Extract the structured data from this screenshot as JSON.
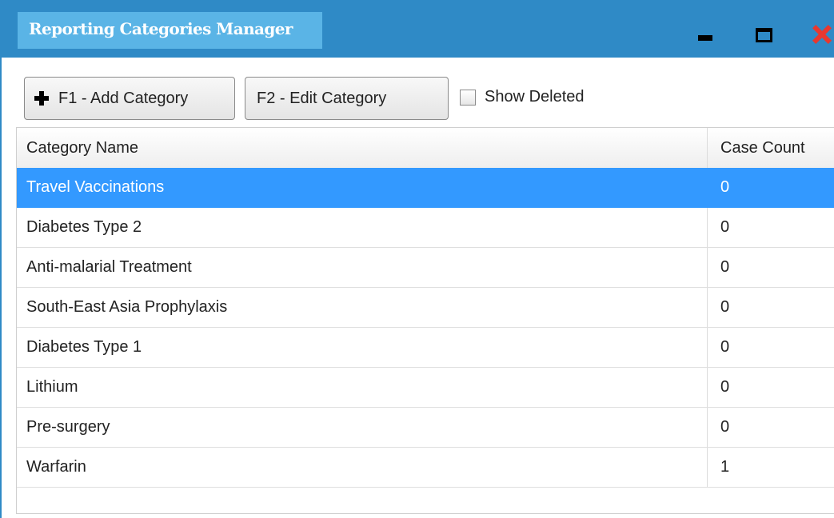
{
  "window": {
    "title": "Reporting Categories Manager",
    "controls": [
      "minimize-icon",
      "maximize-icon",
      "close-icon"
    ],
    "title_bar_color": "#2f8ac6",
    "title_tab_color": "#5ab4e6",
    "close_color": "#e8382f"
  },
  "toolbar": {
    "add_label": "F1 - Add Category",
    "add_icon": "plus-icon",
    "edit_label": "F2 - Edit Category",
    "show_deleted_label": "Show Deleted",
    "show_deleted_checked": false
  },
  "grid": {
    "columns": [
      "Category Name",
      "Case Count"
    ],
    "selected_color": "#3399ff",
    "rows": [
      {
        "name": "Travel Vaccinations",
        "count": "0",
        "selected": true
      },
      {
        "name": "Diabetes Type 2",
        "count": "0",
        "selected": false
      },
      {
        "name": "Anti-malarial Treatment",
        "count": "0",
        "selected": false
      },
      {
        "name": "South-East Asia Prophylaxis",
        "count": "0",
        "selected": false
      },
      {
        "name": "Diabetes Type 1",
        "count": "0",
        "selected": false
      },
      {
        "name": "Lithium",
        "count": "0",
        "selected": false
      },
      {
        "name": "Pre-surgery",
        "count": "0",
        "selected": false
      },
      {
        "name": "Warfarin",
        "count": "1",
        "selected": false
      }
    ]
  }
}
